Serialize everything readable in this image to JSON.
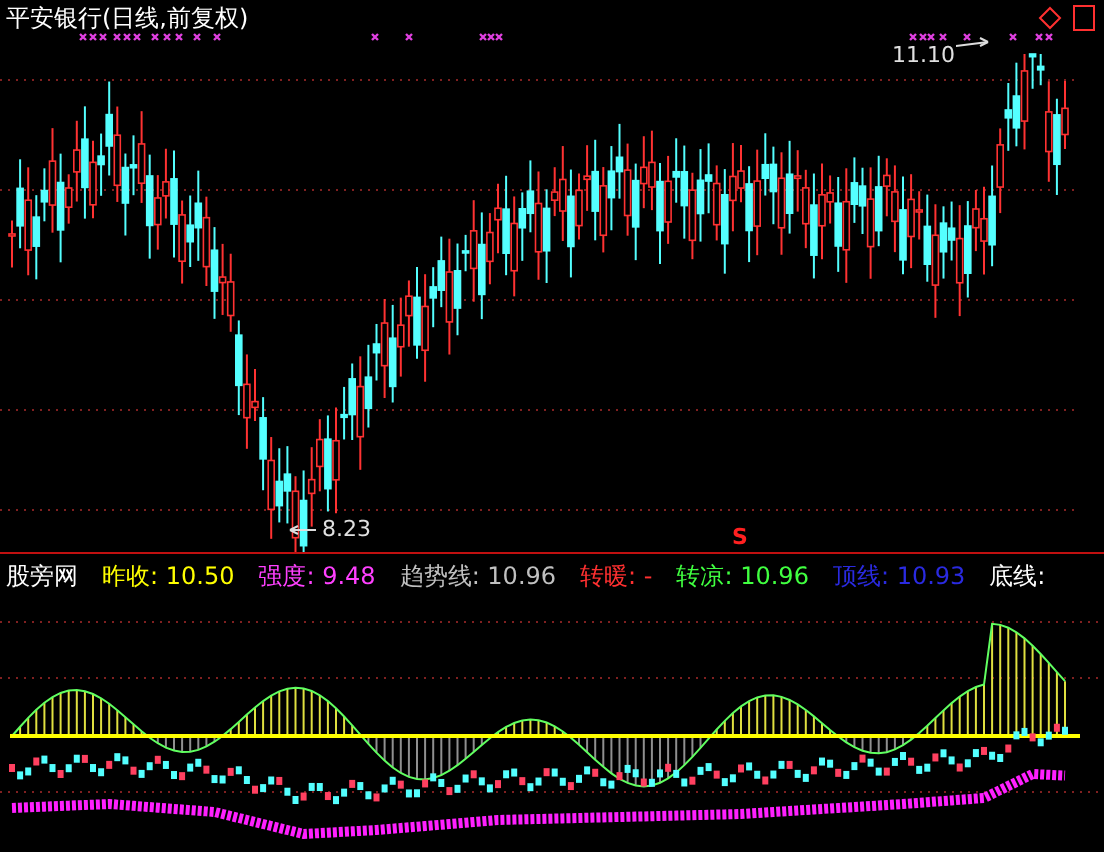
{
  "chart": {
    "title": "平安银行(日线,前复权)",
    "high_label": "11.10",
    "low_label": "8.23",
    "signal_label": "S"
  },
  "indicator": {
    "name": "股旁网",
    "values": [
      {
        "label": "昨收:",
        "value": "10.50",
        "color": "#ffff00"
      },
      {
        "label": "强度:",
        "value": "9.48",
        "color": "#ff40ff"
      },
      {
        "label": "趋势线:",
        "value": "10.96",
        "color": "#c0c0c0"
      },
      {
        "label": "转暖:",
        "value": "-",
        "color": "#ff3030"
      },
      {
        "label": "转凉:",
        "value": "10.96",
        "color": "#40ff40"
      },
      {
        "label": "顶线:",
        "value": "10.93",
        "color": "#2a2ae0"
      },
      {
        "label": "底线:",
        "color": "#ffffff"
      }
    ]
  }
}
